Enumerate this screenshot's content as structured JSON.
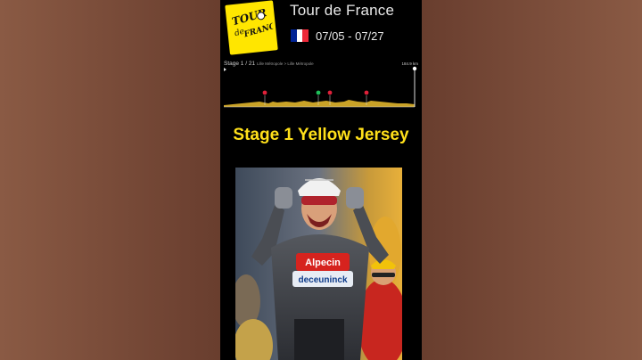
{
  "header": {
    "logo_text_line1": "TOUR",
    "logo_text_line2": "de",
    "logo_text_line3": "FRANCE",
    "title": "Tour de France",
    "dates": "07/05 - 07/27",
    "flag_colors": [
      "#002395",
      "#ffffff",
      "#ed2939"
    ]
  },
  "stage": {
    "label": "Stage 1 / 21",
    "route": "Lille Métropole > Lille Métropole",
    "distance": "184.9 km",
    "markers": [
      {
        "kind": "climb",
        "color": "#e0213a"
      },
      {
        "kind": "sprint",
        "color": "#1fbf5a"
      },
      {
        "kind": "climb",
        "color": "#e0213a"
      },
      {
        "kind": "climb",
        "color": "#e0213a"
      }
    ],
    "profile_color": "#c9a227"
  },
  "headline": "Stage 1 Yellow Jersey",
  "photo": {
    "jersey_brand_top": "Alpecin",
    "jersey_brand_bottom": "deceuninck"
  },
  "colors": {
    "headline": "#ffe01a",
    "logo_yellow": "#ffe600",
    "panel_bg": "#000000"
  }
}
